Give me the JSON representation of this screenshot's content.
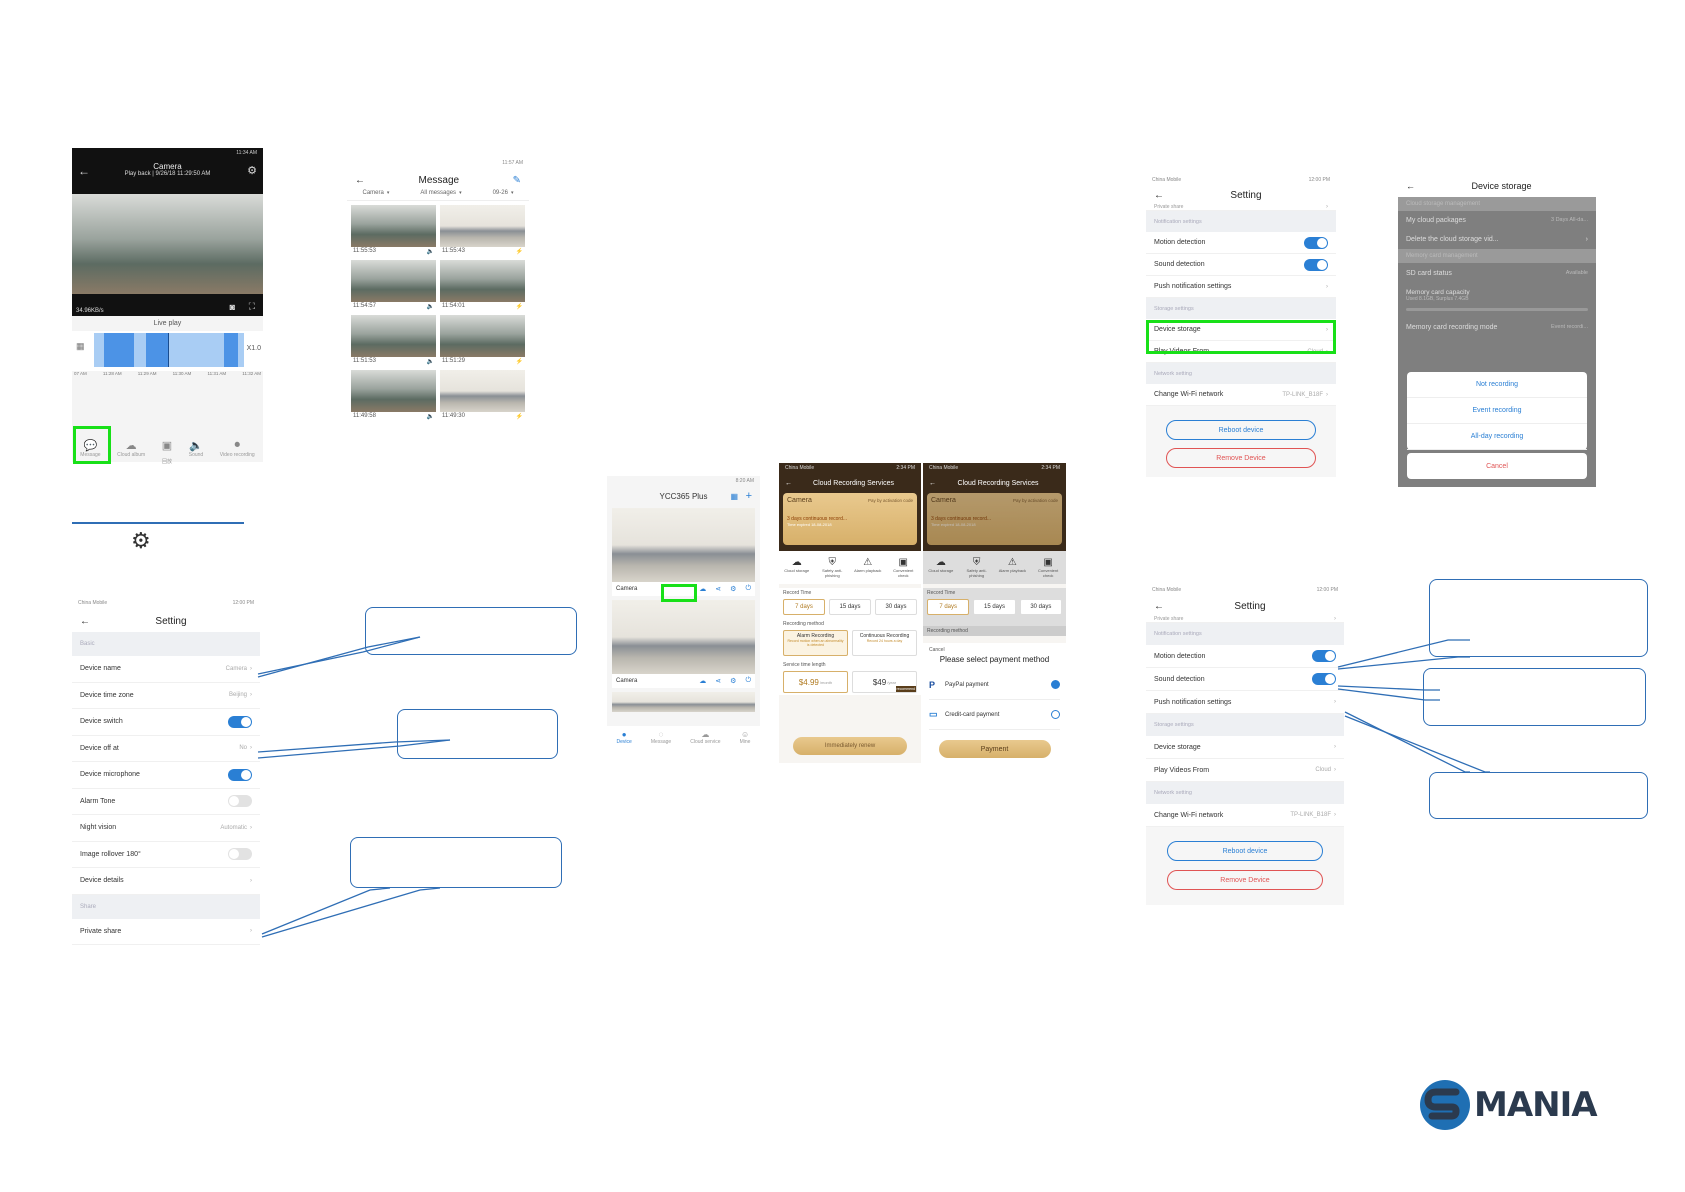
{
  "live": {
    "status_time": "11:34 AM",
    "title": "Camera",
    "subtitle": "Play back | 9/26/18 11:29:50 AM",
    "bitrate": "34.96KB/s",
    "live_play": "Live play",
    "speed": "X1.0",
    "timeline": [
      "07 AM",
      "11:28 AM",
      "11:29 AM",
      "11:30 AM",
      "11:31 AM",
      "11:32 AM"
    ],
    "tabs": [
      {
        "label": "Message",
        "icon": "message-icon"
      },
      {
        "label": "Cloud album",
        "icon": "cloud-icon"
      },
      {
        "label": "",
        "icon": "screenshot-icon"
      },
      {
        "label": "Sound",
        "icon": "speaker-icon"
      },
      {
        "label": "Video recording",
        "icon": "video-record-icon"
      }
    ],
    "under_center": "回放"
  },
  "message": {
    "status_time": "11:57 AM",
    "title": "Message",
    "filters": [
      "Camera",
      "All messages",
      "09-26"
    ],
    "times": [
      "11:55:53",
      "11:55:43",
      "11:54:57",
      "11:54:01",
      "11:51:53",
      "11:51:29",
      "11:49:58",
      "11:49:30"
    ]
  },
  "setting_left": {
    "carrier": "China Mobile",
    "status_time": "12:00 PM",
    "title": "Setting",
    "sections": [
      {
        "header": "Basic",
        "rows": [
          {
            "label": "Device name",
            "value": "Camera",
            "type": "link"
          },
          {
            "label": "Device time zone",
            "value": "Beijing",
            "type": "link"
          },
          {
            "label": "Device switch",
            "value": "",
            "type": "on"
          },
          {
            "label": "Device off at",
            "value": "No",
            "type": "link"
          },
          {
            "label": "Device microphone",
            "value": "",
            "type": "on"
          },
          {
            "label": "Alarm Tone",
            "value": "",
            "type": "off"
          },
          {
            "label": "Night vision",
            "value": "Automatic",
            "type": "link"
          },
          {
            "label": "Image rollover 180°",
            "value": "",
            "type": "off"
          },
          {
            "label": "Device details",
            "value": "",
            "type": "link"
          }
        ]
      },
      {
        "header": "Share",
        "rows": [
          {
            "label": "Private share",
            "value": "",
            "type": "link"
          }
        ]
      }
    ]
  },
  "device_list": {
    "status_time": "8:20 AM",
    "title": "YCC365 Plus",
    "cameras": [
      "Camera",
      "Camera"
    ],
    "tabs": [
      "Device",
      "Message",
      "Cloud service",
      "Mine"
    ]
  },
  "cloud": {
    "carrier": "China Mobile",
    "status_time_a": "2:34 PM",
    "status_time_b": "2:34 PM",
    "title": "Cloud Recording Services",
    "card_title": "Camera",
    "card_right": "Pay by activation code",
    "card_line": "3 days continuous record...",
    "card_line_b": "3 days continuous record...",
    "card_sub": "Time expired 18-08-2018",
    "features": [
      "Cloud storage",
      "Safety anti-phishing",
      "Alarm playback",
      "Convenient check"
    ],
    "record_time_label": "Record Time",
    "record_days": [
      "7 days",
      "15 days",
      "30 days"
    ],
    "method_label": "Recording method",
    "methods": [
      {
        "name": "Alarm Recording",
        "desc": "Record motion when an abnormality is detected"
      },
      {
        "name": "Continuous Recording",
        "desc": "Record 24 hours a day"
      }
    ],
    "service_label": "Service time length",
    "prices": [
      {
        "price": "$4.99",
        "unit": "/month"
      },
      {
        "price": "$49",
        "unit": "/year"
      }
    ],
    "badge": "recommend",
    "renew_button": "Immediately renew",
    "sheet_cancel": "Cancel",
    "pay_title": "Please select payment method",
    "pay_options": [
      "PayPal payment",
      "Credit-card payment"
    ],
    "pay_button": "Payment"
  },
  "setting_tr": {
    "carrier": "China Mobile",
    "status_time": "12:00 PM",
    "title": "Setting",
    "top_row": "Private share",
    "rows": [
      {
        "kind": "sec",
        "label": "Notification settings"
      },
      {
        "kind": "row",
        "label": "Motion detection",
        "type": "on",
        "value": ""
      },
      {
        "kind": "row",
        "label": "Sound detection",
        "type": "on",
        "value": ""
      },
      {
        "kind": "row",
        "label": "Push notification settings",
        "type": "link",
        "value": ""
      },
      {
        "kind": "sec",
        "label": "Storage settings"
      },
      {
        "kind": "row",
        "label": "Device storage",
        "type": "link",
        "value": ""
      },
      {
        "kind": "row",
        "label": "Play Videos From",
        "type": "link",
        "value": "Cloud"
      },
      {
        "kind": "sec",
        "label": "Network setting"
      },
      {
        "kind": "row",
        "label": "Change Wi-Fi network",
        "type": "link",
        "value": "TP-LINK_B18F"
      }
    ],
    "reboot": "Reboot device",
    "remove": "Remove Device"
  },
  "storage": {
    "title": "Device storage",
    "cloud_header": "Cloud storage management",
    "my_packages": "My cloud packages",
    "my_packages_value": "3 Days All-da...",
    "delete_row": "Delete the cloud storage vid...",
    "card_header": "Memory card management",
    "sd_status": "SD card status",
    "sd_value": "Available",
    "capacity": "Memory card capacity",
    "capacity_sub": "Used 8.1GB, Surplus 7.4GB",
    "mode": "Memory card recording mode",
    "mode_value": "Event recordi...",
    "options": [
      "Not recording",
      "Event recording",
      "All-day recording"
    ],
    "cancel": "Cancel"
  },
  "setting_br": {
    "carrier": "China Mobile",
    "status_time": "12:00 PM",
    "title": "Setting",
    "top_row": "Private share",
    "rows": [
      {
        "kind": "sec",
        "label": "Notification settings"
      },
      {
        "kind": "row",
        "label": "Motion detection",
        "type": "on",
        "value": ""
      },
      {
        "kind": "row",
        "label": "Sound detection",
        "type": "on",
        "value": ""
      },
      {
        "kind": "row",
        "label": "Push notification settings",
        "type": "link",
        "value": ""
      },
      {
        "kind": "sec",
        "label": "Storage settings"
      },
      {
        "kind": "row",
        "label": "Device storage",
        "type": "link",
        "value": ""
      },
      {
        "kind": "row",
        "label": "Play Videos From",
        "type": "link",
        "value": "Cloud"
      },
      {
        "kind": "sec",
        "label": "Network setting"
      },
      {
        "kind": "row",
        "label": "Change Wi-Fi network",
        "type": "link",
        "value": "TP-LINK_B18F"
      }
    ],
    "reboot": "Reboot device",
    "remove": "Remove Device"
  },
  "logo": {
    "text": "MANIA",
    "color": "#2b3a4e"
  },
  "colors": {
    "accent": "#2a7fd4",
    "highlight": "#18e018",
    "callout": "#2f6eb5",
    "remove": "#e05454"
  }
}
